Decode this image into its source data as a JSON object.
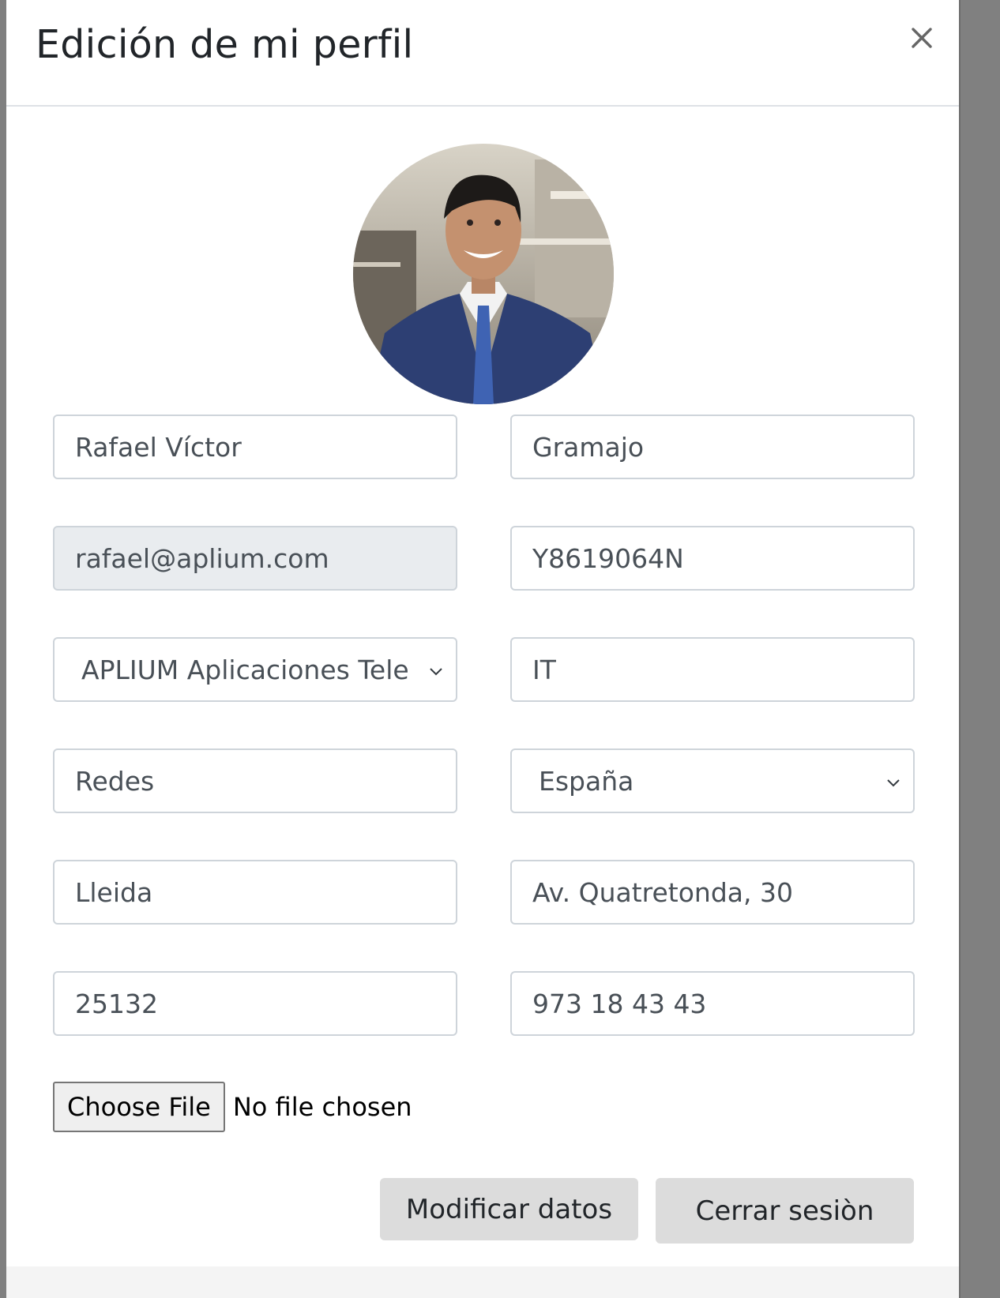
{
  "modal": {
    "title": "Edición de mi perfil",
    "close_icon": "close-icon"
  },
  "profile": {
    "first_name": "Rafael Víctor",
    "last_name": "Gramajo",
    "email": "rafael@aplium.com",
    "document_id": "Y8619064N",
    "company": "APLIUM Aplicaciones Tele",
    "department": "IT",
    "position": "Redes",
    "country": "España",
    "city": "Lleida",
    "address": "Av. Quatretonda, 30",
    "postal_code": "25132",
    "phone": "973 18 43 43"
  },
  "file_input": {
    "button_label": "Choose File",
    "status": "No file chosen"
  },
  "actions": {
    "modify_label": "Modificar datos",
    "logout_label": "Cerrar sesiòn"
  },
  "colors": {
    "overlay": "#808080",
    "input_border": "#ced4da",
    "readonly_bg": "#e9ecef",
    "button_bg": "#dcdcdc"
  }
}
